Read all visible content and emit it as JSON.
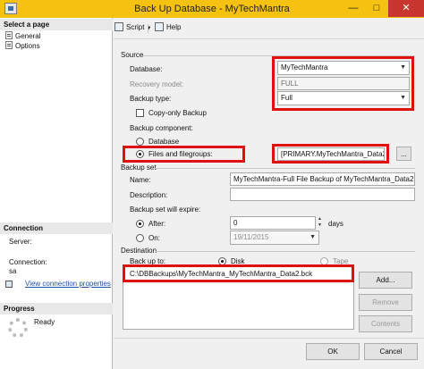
{
  "window": {
    "title": "Back Up Database - MyTechMantra",
    "min_label": "—",
    "max_label": "□",
    "close_label": "✕"
  },
  "left_pane": {
    "select_page_header": "Select a page",
    "pages": [
      {
        "label": "General",
        "icon": "page-icon"
      },
      {
        "label": "Options",
        "icon": "page-icon"
      }
    ],
    "connection_header": "Connection",
    "server_label": "Server:",
    "connection_label": "Connection:",
    "connection_value": "sa",
    "view_connection_link": "View connection properties",
    "progress_header": "Progress",
    "progress_status": "Ready"
  },
  "toolbar": {
    "script_label": "Script",
    "help_label": "Help"
  },
  "source": {
    "group_label": "Source",
    "database_label": "Database:",
    "database_value": "MyTechMantra",
    "recovery_model_label": "Recovery model:",
    "recovery_model_value": "FULL",
    "backup_type_label": "Backup type:",
    "backup_type_value": "Full",
    "copy_only_label": "Copy-only Backup",
    "copy_only_checked": false,
    "backup_component_label": "Backup component:",
    "component_options": [
      {
        "label": "Database",
        "selected": false
      },
      {
        "label": "Files and filegroups:",
        "selected": true
      }
    ],
    "filegroup_value": "[PRIMARY.MyTechMantra_Data2]",
    "browse_label": "..."
  },
  "backup_set": {
    "group_label": "Backup set",
    "name_label": "Name:",
    "name_value": "MyTechMantra-Full File Backup of MyTechMantra_Data2 File",
    "description_label": "Description:",
    "description_value": "",
    "expire_label": "Backup set will expire:",
    "after_label": "After:",
    "after_selected": true,
    "after_value": "0",
    "days_label": "days",
    "on_label": "On:",
    "on_selected": false,
    "on_value": "19/11/2015"
  },
  "destination": {
    "group_label": "Destination",
    "back_up_to_label": "Back up to:",
    "disk_label": "Disk",
    "disk_selected": true,
    "tape_label": "Tape",
    "tape_selected": false,
    "paths": [
      "C:\\DBBackups\\MyTechMantra_MyTechMantra_Data2.bck"
    ],
    "add_label": "Add...",
    "remove_label": "Remove",
    "contents_label": "Contents"
  },
  "footer": {
    "ok_label": "OK",
    "cancel_label": "Cancel"
  },
  "colors": {
    "title_bar": "#f5c211",
    "highlight_box": "#e01010",
    "close_button": "#c7372f",
    "link": "#1f4fa3"
  }
}
